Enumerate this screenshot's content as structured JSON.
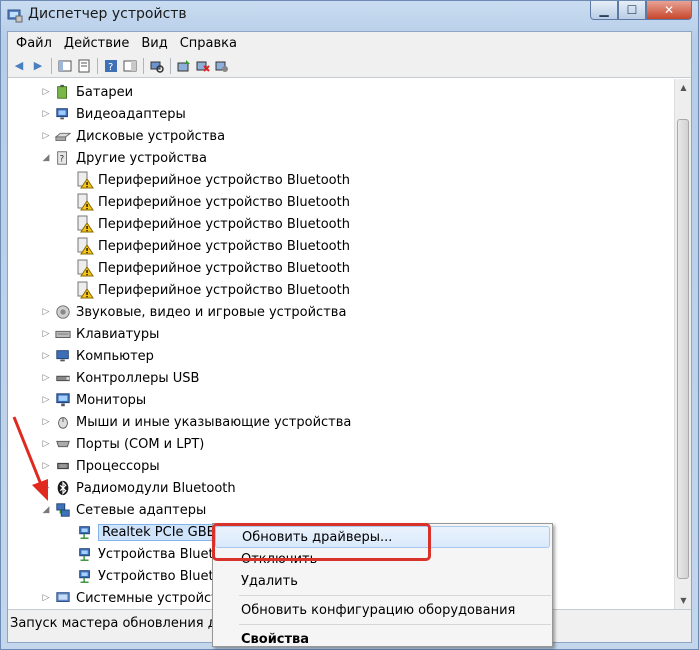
{
  "window": {
    "title": "Диспетчер устройств"
  },
  "menu": [
    "Файл",
    "Действие",
    "Вид",
    "Справка"
  ],
  "tree": [
    {
      "label": "Батареи",
      "level": 1,
      "expander": "collapsed",
      "icon": "battery-icon"
    },
    {
      "label": "Видеоадаптеры",
      "level": 1,
      "expander": "collapsed",
      "icon": "display-adapter-icon"
    },
    {
      "label": "Дисковые устройства",
      "level": 1,
      "expander": "collapsed",
      "icon": "disk-drive-icon"
    },
    {
      "label": "Другие устройства",
      "level": 1,
      "expander": "expanded",
      "icon": "other-devices-icon"
    },
    {
      "label": "Периферийное устройство Bluetooth",
      "level": 2,
      "icon": "unknown-device-warning-icon"
    },
    {
      "label": "Периферийное устройство Bluetooth",
      "level": 2,
      "icon": "unknown-device-warning-icon"
    },
    {
      "label": "Периферийное устройство Bluetooth",
      "level": 2,
      "icon": "unknown-device-warning-icon"
    },
    {
      "label": "Периферийное устройство Bluetooth",
      "level": 2,
      "icon": "unknown-device-warning-icon"
    },
    {
      "label": "Периферийное устройство Bluetooth",
      "level": 2,
      "icon": "unknown-device-warning-icon"
    },
    {
      "label": "Периферийное устройство Bluetooth",
      "level": 2,
      "icon": "unknown-device-warning-icon"
    },
    {
      "label": "Звуковые, видео и игровые устройства",
      "level": 1,
      "expander": "collapsed",
      "icon": "sound-icon"
    },
    {
      "label": "Клавиатуры",
      "level": 1,
      "expander": "collapsed",
      "icon": "keyboard-icon"
    },
    {
      "label": "Компьютер",
      "level": 1,
      "expander": "collapsed",
      "icon": "computer-icon"
    },
    {
      "label": "Контроллеры USB",
      "level": 1,
      "expander": "collapsed",
      "icon": "usb-icon"
    },
    {
      "label": "Мониторы",
      "level": 1,
      "expander": "collapsed",
      "icon": "monitor-icon"
    },
    {
      "label": "Мыши и иные указывающие устройства",
      "level": 1,
      "expander": "collapsed",
      "icon": "mouse-icon"
    },
    {
      "label": "Порты (COM и LPT)",
      "level": 1,
      "expander": "collapsed",
      "icon": "port-icon"
    },
    {
      "label": "Процессоры",
      "level": 1,
      "expander": "collapsed",
      "icon": "processor-icon"
    },
    {
      "label": "Радиомодули Bluetooth",
      "level": 1,
      "expander": "collapsed",
      "icon": "bluetooth-icon"
    },
    {
      "label": "Сетевые адаптеры",
      "level": 1,
      "expander": "expanded",
      "icon": "network-adapter-icon"
    },
    {
      "label": "Realtek PCIe GBE F",
      "level": 2,
      "icon": "network-card-icon",
      "selected": true
    },
    {
      "label": "Устройства Blueto",
      "level": 2,
      "icon": "network-card-icon"
    },
    {
      "label": "Устройство Blueto",
      "level": 2,
      "icon": "network-card-icon"
    },
    {
      "label": "Системные устройст",
      "level": 1,
      "expander": "collapsed",
      "icon": "system-devices-icon"
    }
  ],
  "status": {
    "text": "Запуск мастера обновления дра"
  },
  "context_menu": {
    "items": [
      {
        "label": "Обновить драйверы...",
        "highlighted": true
      },
      {
        "label": "Отключить"
      },
      {
        "label": "Удалить"
      },
      {
        "separator": true
      },
      {
        "label": "Обновить конфигурацию оборудования"
      },
      {
        "separator": true
      },
      {
        "label": "Свойства",
        "bold": true
      }
    ]
  },
  "colors": {
    "highlight_box": "#d9322b",
    "arrow": "#e0291f",
    "selection": "#cfe3fb"
  }
}
